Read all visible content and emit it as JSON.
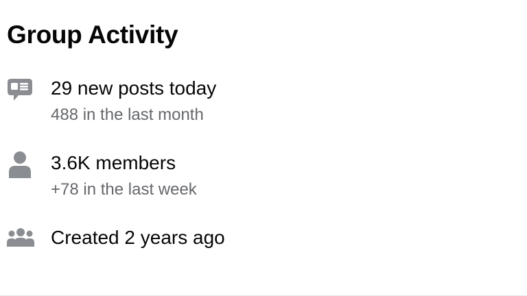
{
  "header": {
    "title": "Group Activity"
  },
  "stats": {
    "posts": {
      "icon": "message-icon",
      "primary": "29 new posts today",
      "secondary": "488 in the last month"
    },
    "members": {
      "icon": "person-icon",
      "primary": "3.6K members",
      "secondary": "+78 in the last week"
    },
    "created": {
      "icon": "group-icon",
      "primary": "Created 2 years ago"
    }
  },
  "colors": {
    "text_primary": "#050505",
    "text_secondary": "#65676b",
    "icon": "#8a8d91",
    "background": "#ffffff"
  }
}
